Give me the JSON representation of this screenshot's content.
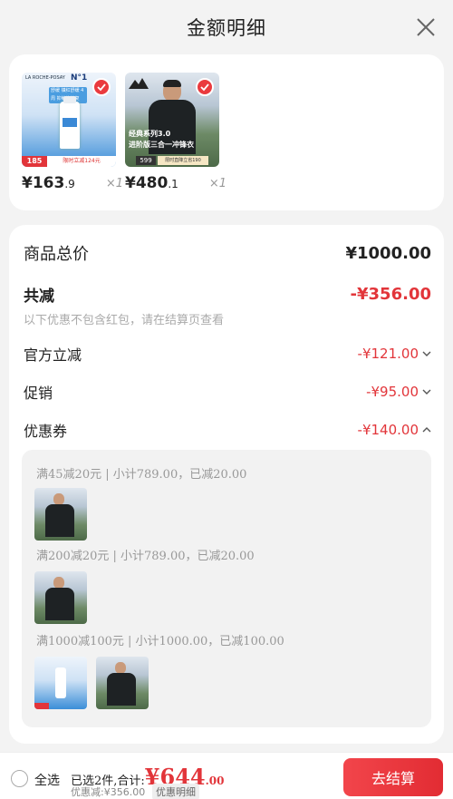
{
  "header": {
    "title": "金额明细"
  },
  "products": [
    {
      "price_main": "¥163",
      "price_decimal": ".9",
      "qty": "×1",
      "badge": "185",
      "promo": "限时立减124元",
      "brand": "LA ROCHE-POSAY",
      "line1": "N°1",
      "tagline": "舒缓 镇红舒缓 4周 抑敏修护复"
    },
    {
      "price_main": "¥480",
      "price_decimal": ".1",
      "qty": "×1",
      "badge": "599",
      "promo": "限时直降立省190",
      "line1": "经典系列3.0",
      "line2": "进阶版三合一冲锋衣"
    }
  ],
  "summary": {
    "total_label": "商品总价",
    "total_value": "¥1000.00",
    "discount_label": "共减",
    "discount_value": "-¥356.00",
    "note": "以下优惠不包含红包，请在结算页查看",
    "official_label": "官方立减",
    "official_value": "-¥121.00",
    "promo_label": "促销",
    "promo_value": "-¥95.00",
    "coupon_label": "优惠券",
    "coupon_value": "-¥140.00"
  },
  "coupons": [
    {
      "text": "满45减20元 | 小计789.00，已减20.00"
    },
    {
      "text": "满200减20元 | 小计789.00，已减20.00"
    },
    {
      "text": "满1000减100元 | 小计1000.00，已减100.00"
    }
  ],
  "bottom": {
    "select_all": "全选",
    "selected_text": "已选2件,合计:",
    "total_main": "¥644",
    "total_decimal": ".00",
    "discount_text": "优惠减:¥356.00",
    "detail_link": "优惠明细",
    "pay_button": "去结算"
  },
  "colors": {
    "accent": "#e2353a"
  }
}
